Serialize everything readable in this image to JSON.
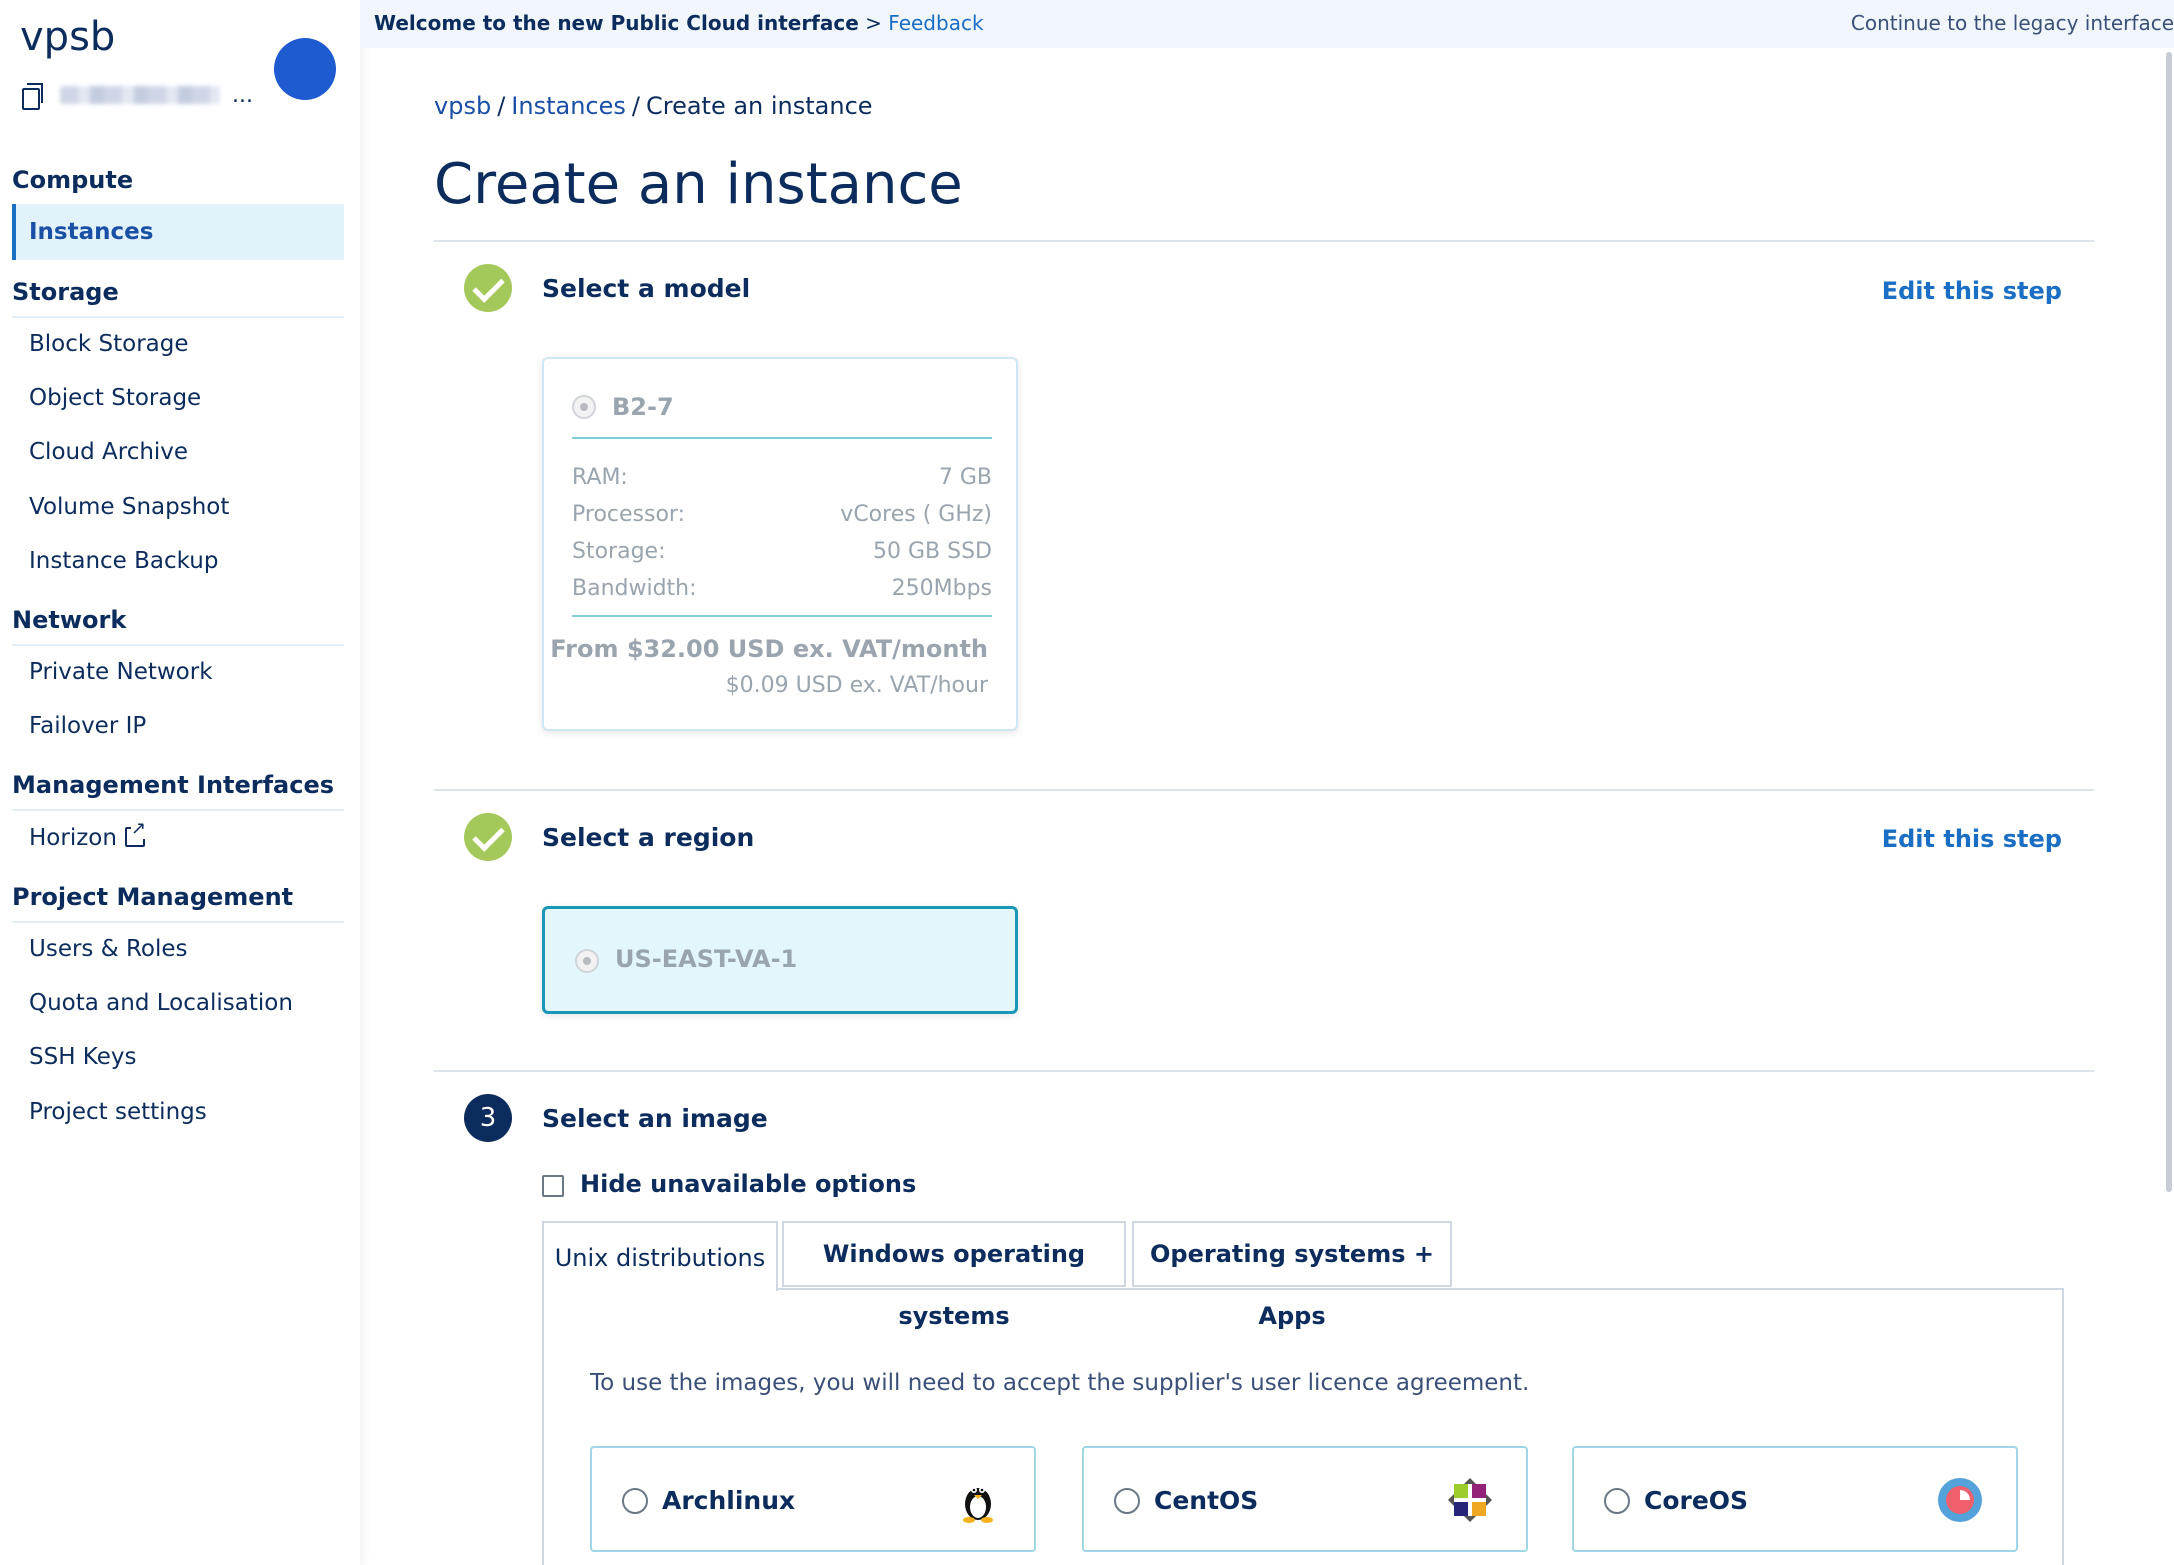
{
  "banner": {
    "welcome": "Welcome to the new Public Cloud interface",
    "separator": ">",
    "feedback": "Feedback",
    "legacy": "Continue to the legacy interface"
  },
  "sidebar": {
    "project_name": "vpsb",
    "id_ellipsis": "...",
    "sections": {
      "compute": "Compute",
      "storage": "Storage",
      "network": "Network",
      "management": "Management Interfaces",
      "project": "Project Management"
    },
    "items": {
      "instances": "Instances",
      "block_storage": "Block Storage",
      "object_storage": "Object Storage",
      "cloud_archive": "Cloud Archive",
      "volume_snapshot": "Volume Snapshot",
      "instance_backup": "Instance Backup",
      "private_network": "Private Network",
      "failover_ip": "Failover IP",
      "horizon": "Horizon",
      "users_roles": "Users & Roles",
      "quota": "Quota and Localisation",
      "ssh_keys": "SSH Keys",
      "project_settings": "Project settings"
    }
  },
  "breadcrumb": {
    "project": "vpsb",
    "instances": "Instances",
    "current": "Create an instance",
    "separator": "/"
  },
  "page": {
    "title": "Create an instance"
  },
  "steps": {
    "model": {
      "title": "Select a model",
      "edit": "Edit this step",
      "card": {
        "name": "B2-7",
        "specs": [
          {
            "label": "RAM:",
            "value": "7 GB"
          },
          {
            "label": "Processor:",
            "value": "vCores ( GHz)"
          },
          {
            "label": "Storage:",
            "value": "50 GB SSD"
          },
          {
            "label": "Bandwidth:",
            "value": "250Mbps"
          }
        ],
        "price_month": "From $32.00 USD ex. VAT/month",
        "price_hour": "$0.09 USD ex. VAT/hour"
      }
    },
    "region": {
      "title": "Select a region",
      "edit": "Edit this step",
      "selected": "US-EAST-VA-1"
    },
    "image": {
      "number": "3",
      "title": "Select an image",
      "hide_unavailable": "Hide unavailable options",
      "tabs": [
        "Unix distributions",
        "Windows operating systems",
        "Operating systems + Apps"
      ],
      "licence_note": "To use the images, you will need to accept the supplier's user licence agreement.",
      "options": [
        "Archlinux",
        "CentOS",
        "CoreOS"
      ]
    }
  },
  "colors": {
    "navy": "#0b2c5c",
    "link": "#1a6ec4",
    "check_green": "#a4c85a",
    "region_border": "#1a96b6",
    "region_bg": "#e2f6fb"
  }
}
